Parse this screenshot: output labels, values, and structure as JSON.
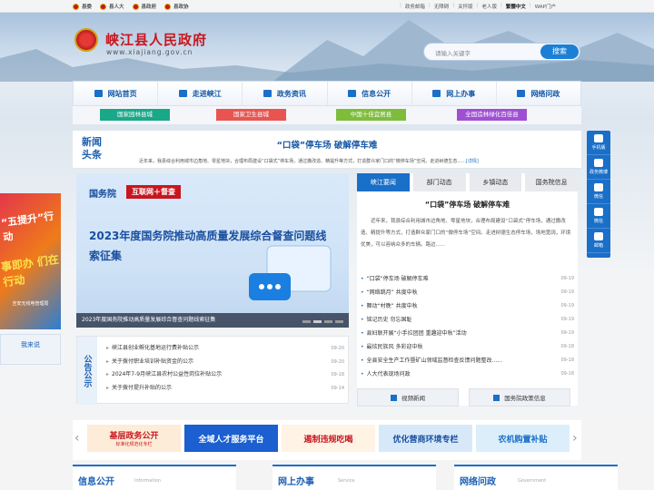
{
  "topbar": {
    "left": [
      "县委",
      "县人大",
      "县政府",
      "县政协"
    ],
    "right": [
      "政务邮箱",
      "无障碍",
      "关怀版",
      "老人版",
      "繁體中文",
      "WAP门户"
    ]
  },
  "header": {
    "title": "峡江县人民政府",
    "domain": "www.xiajiang.gov.cn",
    "search_placeholder": "请输入关键字",
    "search_button": "搜索"
  },
  "nav": [
    "网站首页",
    "走进峡江",
    "政务资讯",
    "信息公开",
    "网上办事",
    "网络问政"
  ],
  "tags": [
    {
      "label": "国家园林县城",
      "color": "#1aa889"
    },
    {
      "label": "国家卫生县城",
      "color": "#e85550"
    },
    {
      "label": "中国十佳宜居县",
      "color": "#7ebd3c"
    },
    {
      "label": "全国造林绿化百佳县",
      "color": "#a04fd3"
    }
  ],
  "headline": {
    "label1": "新闻",
    "label2": "头条",
    "title": "“口袋”停车场 破解停车难",
    "summary": "近年来，我县综合利用城市边角地、零星地块，合理布局建设“口袋式”停车场，通过撒改造、精提升等方式，打造群众家门口的“微停车场”空间。走进树德生态......",
    "more": "[详情]"
  },
  "banner": {
    "tag1": "国务院",
    "tag2": "互联网＋督查",
    "title": "2023年度国务院推动高质量发展综合督查问题线索征集",
    "caption": "2023年度国务院推动高质量发展综合督查问题线索征集"
  },
  "announcements": {
    "label": "公告公示",
    "items": [
      {
        "t": "峡江县创业孵化基地运行费补贴公示",
        "d": "09-20"
      },
      {
        "t": "关于拨付职业培训补贴资金的公示",
        "d": "09-20"
      },
      {
        "t": "2024年7-9月峡江县农村公益性岗位补贴公示",
        "d": "09-18"
      },
      {
        "t": "关于拨付提升补贴的公示",
        "d": "09-14"
      }
    ]
  },
  "right": {
    "tabs": [
      "峡江要闻",
      "部门动态",
      "乡镇动态",
      "国务院信息"
    ],
    "headline": "“口袋”停车场 破解停车难",
    "summary": "近年来，我县综合利用城市边角地、零星地块，合理布局建设“口袋式”停车场，通过撒改造、精提升等方式，打造群众家门口的“微停车场”空间。走进树德生态停车场，场地宽阔，环境优美，可以容纳众多的车辆。路边......",
    "news": [
      {
        "t": "“口袋”停车场 破解停车难",
        "d": "09-19"
      },
      {
        "t": "“网络跳月” 共度中秋",
        "d": "09-19"
      },
      {
        "t": "舞动“村晚” 共度中秋",
        "d": "09-19"
      },
      {
        "t": "铭记历史 勿忘国耻",
        "d": "09-19"
      },
      {
        "t": "县妇联开展“小手拉团团 重趣迎中秋”活动",
        "d": "09-19"
      },
      {
        "t": "最炫民族风 多彩迎中秋",
        "d": "09-18"
      },
      {
        "t": "全县安全生产工作暨矿山领域监督检查反馈问题整改......",
        "d": "09-18"
      },
      {
        "t": "人大代表现场问政",
        "d": "09-18"
      }
    ],
    "btn1": "视频新闻",
    "btn2": "国务院政策信息"
  },
  "promos": [
    {
      "label": "基层政务公开",
      "sub": "标准化规范化专栏",
      "bg": "#fdecd8",
      "fg": "#c8161e"
    },
    {
      "label": "全域人才服务平台",
      "sub": "",
      "bg": "#1b5fd0",
      "fg": "#ffffff"
    },
    {
      "label": "遏制违规吃喝",
      "sub": "",
      "bg": "#fff3e6",
      "fg": "#c8161e"
    },
    {
      "label": "优化营商环境专栏",
      "sub": "",
      "bg": "#d7e9f8",
      "fg": "#1a4fa0"
    },
    {
      "label": "农机购置补贴",
      "sub": "",
      "bg": "#dbeefa",
      "fg": "#1a6fc8"
    }
  ],
  "bottom": [
    {
      "label": "信息公开",
      "en": "Information"
    },
    {
      "label": "网上办事",
      "en": "Service"
    },
    {
      "label": "网络问政",
      "en": "Government"
    }
  ],
  "side": [
    "手机版",
    "政务微博",
    "微信",
    "微信",
    "邮箱"
  ],
  "leftad": {
    "t1": "“五提升”行动",
    "t2": "事即办 们在行动",
    "t3": "吉安无线电管理局"
  },
  "leftad2": "我来说"
}
